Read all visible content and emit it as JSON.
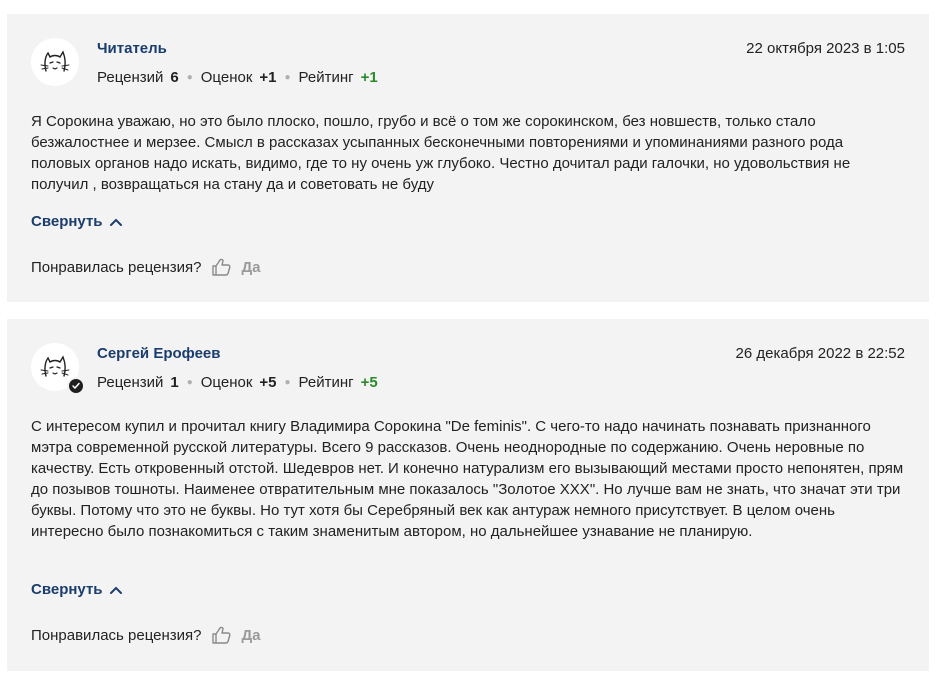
{
  "reviews": [
    {
      "author": "Читатель",
      "date": "22 октября 2023 в 1:05",
      "reviews_label": "Рецензий",
      "reviews_count": "6",
      "ratings_label": "Оценок",
      "ratings_count": "+1",
      "rating_label": "Рейтинг",
      "rating_value": "+1",
      "verified": false,
      "text": "Я Сорокина уважаю, но это было плоско, пошло, грубо и всё о том же сорокинском, без новшеств, только стало безжалостнее и мерзее. Смысл в рассказах усыпанных бесконечными повторениями и упоминаниями разного рода половых органов надо искать, видимо, где то ну очень уж глубоко. Честно дочитал ради галочки, но удовольствия не получил , возвращаться на стану да и советовать не буду",
      "collapse_label": "Свернуть",
      "liked_question": "Понравилась рецензия?",
      "yes_label": "Да"
    },
    {
      "author": "Сергей Ерофеев",
      "date": "26 декабря 2022 в 22:52",
      "reviews_label": "Рецензий",
      "reviews_count": "1",
      "ratings_label": "Оценок",
      "ratings_count": "+5",
      "rating_label": "Рейтинг",
      "rating_value": "+5",
      "verified": true,
      "text": "С интересом купил и прочитал книгу Владимира Сорокина \"De feminis\". С чего-то надо начинать познавать признанного мэтра современной русской литературы. Всего 9 рассказов. Очень неоднородные по содержанию. Очень неровные по качеству. Есть откровенный отстой. Шедевров нет. И конечно натурализм его вызывающий местами просто непонятен, прям до позывов тошноты. Наименее отвратительным мне показалось \"Золотое ХХХ\". Но лучше вам не знать, что значат эти три буквы. Потому что это не буквы. Но тут хотя бы Серебряный век как антураж немного присутствует. В целом очень интересно было познакомиться с таким знаменитым автором, но дальнейшее узнавание не планирую.",
      "collapse_label": "Свернуть",
      "liked_question": "Понравилась рецензия?",
      "yes_label": "Да"
    }
  ],
  "colors": {
    "card_bg": "#f3f3f3",
    "link": "#1a3d6e",
    "positive": "#2a8a2a",
    "muted": "#9a9a9a"
  },
  "icons": {
    "avatar": "cat-sketch-icon",
    "like": "thumbs-up-icon",
    "collapse": "chevron-up-icon",
    "verified": "check-badge-icon"
  }
}
